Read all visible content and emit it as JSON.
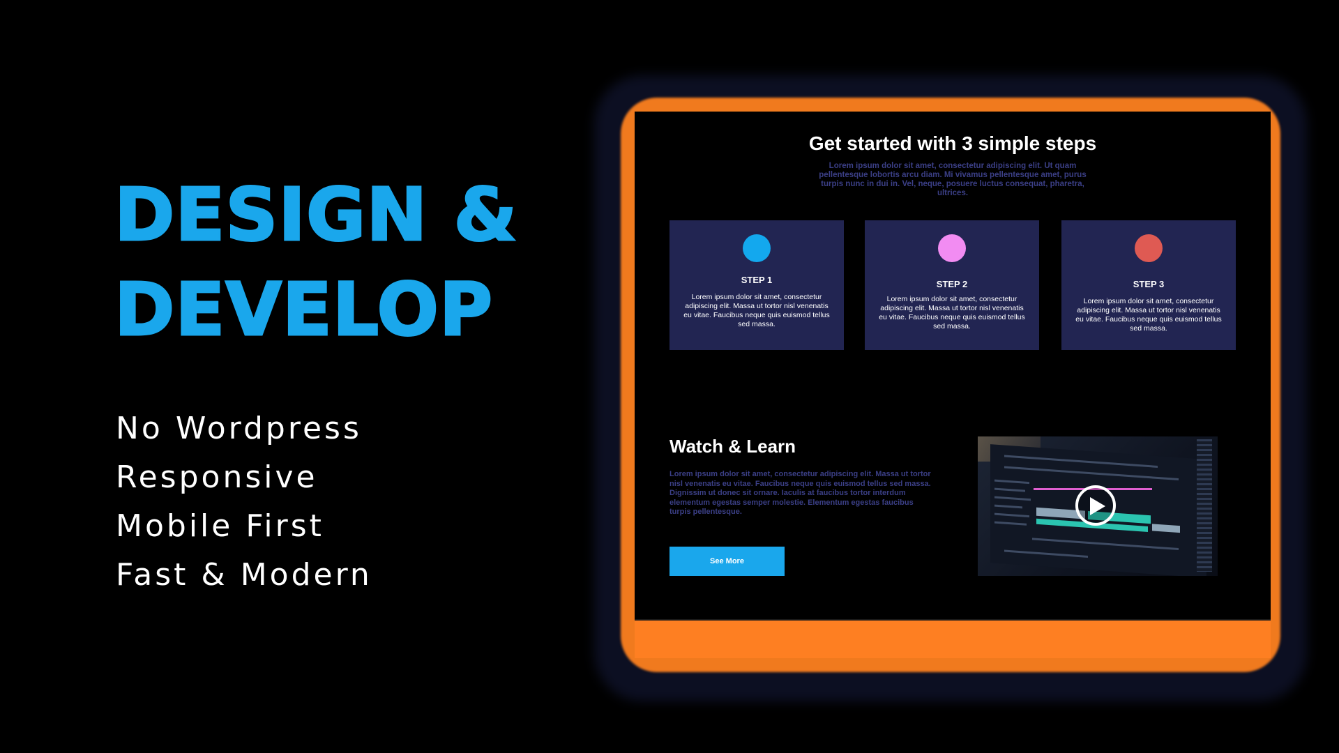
{
  "headline": {
    "line1": "DESIGN &",
    "line2": "DEVELOP"
  },
  "features": [
    "No Wordpress",
    "Responsive",
    "Mobile First",
    "Fast & Modern"
  ],
  "mockup": {
    "title": "Get started with 3 simple steps",
    "subtitle": "Lorem ipsum dolor sit amet, consectetur adipiscing elit. Ut quam pellentesque lobortis arcu diam. Mi vivamus pellentesque amet, purus turpis nunc in dui in. Vel, neque, posuere luctus consequat, pharetra, ultrices.",
    "steps": [
      {
        "label": "STEP 1",
        "text": "Lorem ipsum dolor sit amet, consectetur adipiscing elit. Massa ut tortor nisl venenatis eu vitae. Faucibus neque quis euismod tellus sed massa.",
        "color": "#13A8EE"
      },
      {
        "label": "STEP 2",
        "text": "Lorem ipsum dolor sit amet, consectetur adipiscing elit. Massa ut tortor nisl venenatis eu vitae. Faucibus neque quis euismod tellus sed massa.",
        "color": "#F28CF2"
      },
      {
        "label": "STEP 3",
        "text": "Lorem ipsum dolor sit amet, consectetur adipiscing elit. Massa ut tortor nisl venenatis eu vitae. Faucibus neque quis euismod tellus sed massa.",
        "color": "#DF5A53"
      }
    ],
    "watch": {
      "title": "Watch & Learn",
      "text": "Lorem ipsum dolor sit amet, consectetur adipiscing elit. Massa ut tortor nisl venenatis eu vitae. Faucibus neque quis euismod tellus sed massa. Dignissim ut donec sit ornare. Iaculis at faucibus tortor interdum elementum egestas semper molestie. Elementum egestas faucibus turpis pellentesque.",
      "button_label": "See More",
      "video_icon": "play-icon"
    }
  },
  "colors": {
    "accent_blue": "#1AA7EC",
    "frame_orange": "#F07A1E",
    "footer_orange": "#FE7F22",
    "card_bg": "#222552",
    "muted_text": "#3B3F86",
    "background": "#000000"
  }
}
